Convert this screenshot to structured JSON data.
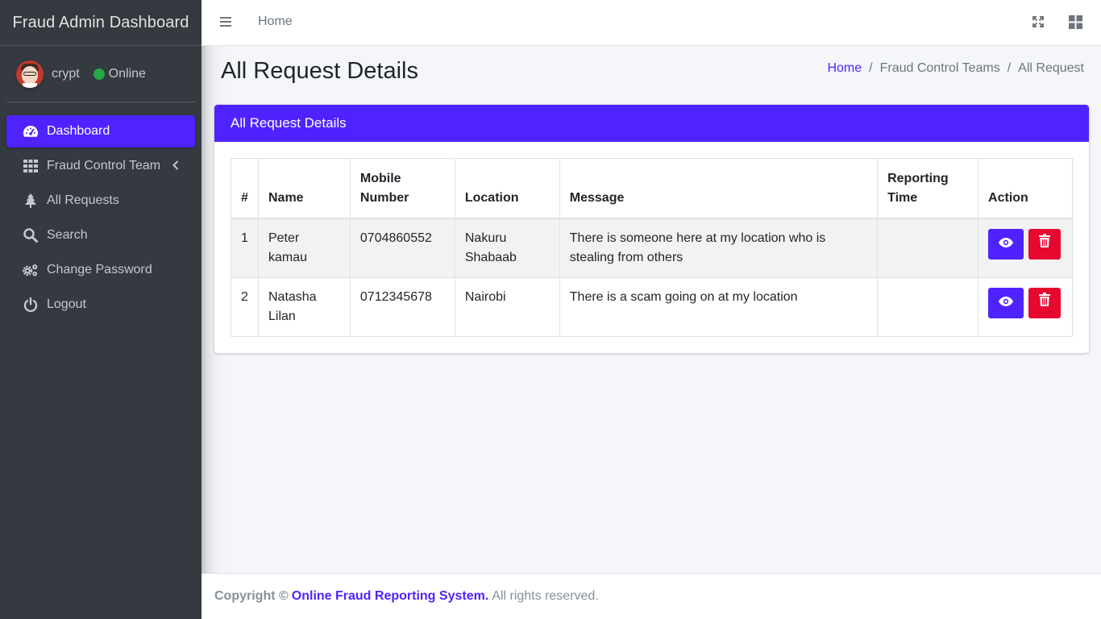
{
  "app": {
    "brand_title": "Fraud Admin Dashboard"
  },
  "user": {
    "name": "crypt",
    "status": "Online",
    "status_color": "#28a745"
  },
  "sidebar": {
    "items": [
      {
        "label": "Dashboard",
        "icon": "tachometer-icon",
        "active": true
      },
      {
        "label": "Fraud Control Team",
        "icon": "grid-icon",
        "has_submenu": true
      },
      {
        "label": "All Requests",
        "icon": "tree-icon"
      },
      {
        "label": "Search",
        "icon": "search-icon"
      },
      {
        "label": "Change Password",
        "icon": "gears-icon"
      },
      {
        "label": "Logout",
        "icon": "power-icon"
      }
    ]
  },
  "topbar": {
    "home_label": "Home",
    "icons": [
      "hamburger-icon",
      "expand-icon",
      "grid-icon"
    ]
  },
  "page": {
    "title": "All Request Details",
    "breadcrumb": [
      "Home",
      "Fraud Control Teams",
      "All Request"
    ]
  },
  "card": {
    "title": "All Request Details",
    "columns": [
      "#",
      "Name",
      "Mobile Number",
      "Location",
      "Message",
      "Reporting Time",
      "Action"
    ],
    "rows": [
      {
        "num": "1",
        "name": "Peter kamau",
        "mobile": "0704860552",
        "location": "Nakuru Shabaab",
        "message": "There is someone here at my location who is stealing from others",
        "time": ""
      },
      {
        "num": "2",
        "name": "Natasha Lilan",
        "mobile": "0712345678",
        "location": "Nairobi",
        "message": "There is a scam going on at my location",
        "time": ""
      }
    ]
  },
  "footer": {
    "copyright": "Copyright ©",
    "link_text": "Online Fraud Reporting System.",
    "rest": "All rights reserved."
  },
  "colors": {
    "accent": "#4f23ff",
    "danger": "#e6082f",
    "sidebar_bg": "#343a40"
  }
}
